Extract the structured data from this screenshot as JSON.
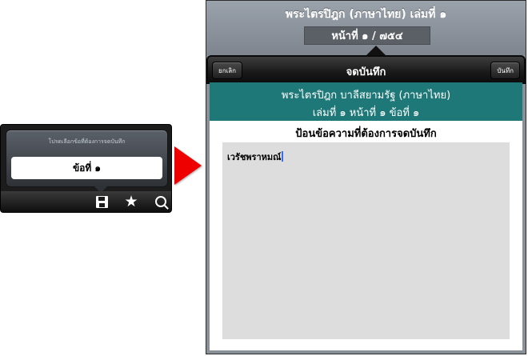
{
  "mini": {
    "popover_title": "โปรดเลือกข้อที่ต้องการจดบันทึก",
    "option_label": "ข้อที่ ๑",
    "toolbar_icons": [
      "save-icon",
      "star-icon",
      "search-icon"
    ]
  },
  "arrow_color": "#ee0000",
  "main": {
    "book_title": "พระไตรปิฎก (ภาษาไทย) เล่มที่ ๑",
    "page_indicator": "หน้าที่ ๑ / ๗๕๔",
    "nav": {
      "title": "จดบันทึก",
      "cancel_label": "ยกเลิก",
      "save_label": "บันทึก"
    },
    "header": {
      "line1": "พระไตรปิฎก บาลีสยามรัฐ (ภาษาไทย)",
      "line2": "เล่มที่ ๑ หน้าที่ ๑ ข้อที่ ๑"
    },
    "prompt": "ป้อนข้อความที่ต้องการจดบันทึก",
    "note_value": "เวรัชพราหมณ์"
  },
  "colors": {
    "teal": "#1f7878",
    "note_bg": "#dddddd"
  }
}
